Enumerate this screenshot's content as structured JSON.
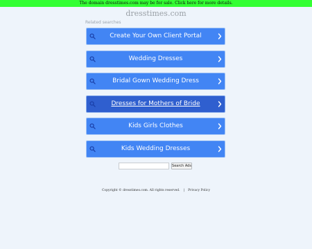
{
  "banner": {
    "text": "The domain dresstimes.com may be for sale. Click here for more details."
  },
  "header": {
    "domain": "dresstimes.com"
  },
  "related": {
    "label": "Related searches",
    "links": [
      {
        "label": "Create Your Own Client Portal"
      },
      {
        "label": "Wedding Dresses"
      },
      {
        "label": "Bridal Gown Wedding Dress"
      },
      {
        "label": "Dresses for Mothers of Bride"
      },
      {
        "label": "Kids Girls Clothes"
      },
      {
        "label": "Kids Wedding Dresses"
      }
    ],
    "active_index": 3
  },
  "search": {
    "value": "",
    "button_label": "Search Ads"
  },
  "footer": {
    "copyright": "Copyright © dresstimes.com.  All rights reserved.",
    "separator": "|",
    "privacy_label": "Privacy Policy"
  },
  "colors": {
    "banner_bg": "#33ff33",
    "page_bg": "#eef4fb",
    "button_bg": "#4285f4",
    "button_active_bg": "#2f5fcf"
  },
  "icons": {
    "link_left": "search-icon",
    "link_right": "chevron-right-icon"
  }
}
